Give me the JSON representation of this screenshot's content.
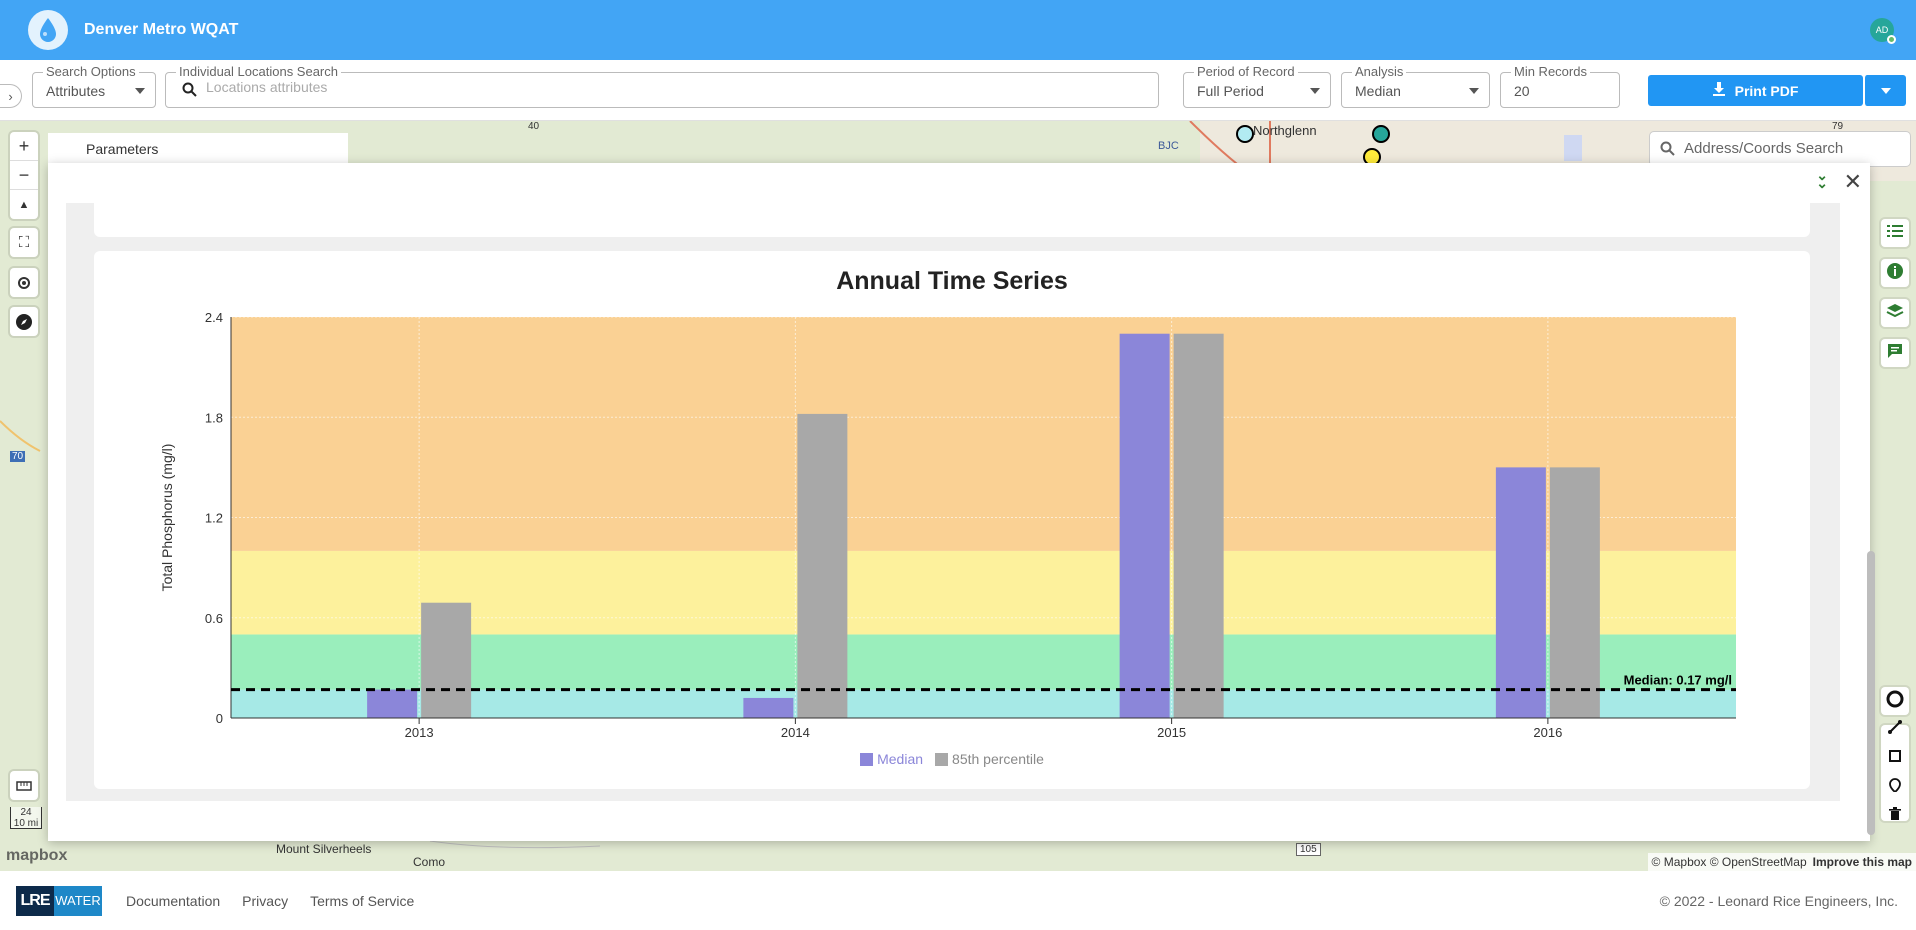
{
  "header": {
    "app_title": "Denver Metro WQAT",
    "avatar_initials": "AD"
  },
  "toolbar": {
    "search_options_label": "Search Options",
    "search_options_value": "Attributes",
    "locations_label": "Individual Locations Search",
    "locations_placeholder": "Locations attributes",
    "period_label": "Period of Record",
    "period_value": "Full Period",
    "analysis_label": "Analysis",
    "analysis_value": "Median",
    "min_records_label": "Min Records",
    "min_records_value": "20",
    "print_label": "Print PDF"
  },
  "map": {
    "address_placeholder": "Address/Coords Search",
    "place_northglenn": "Northglenn",
    "place_bjc": "BJC",
    "place_mount_silverheels": "Mount Silverheels",
    "place_como": "Como",
    "road_40": "40",
    "road_70": "70",
    "road_105": "105",
    "road_79": "79",
    "scale_value": "24",
    "scale_unit": "10 mi",
    "mapbox_text": "mapbox",
    "attribution": "© Mapbox © OpenStreetMap",
    "improve": "Improve this map",
    "panel_label": "Parameters"
  },
  "chart_data": {
    "type": "bar",
    "title": "Annual Time Series",
    "ylabel": "Total Phosphorus (mg/l)",
    "xlabel": "",
    "categories": [
      "2013",
      "2014",
      "2015",
      "2016"
    ],
    "series": [
      {
        "name": "Median",
        "values": [
          0.17,
          0.12,
          2.3,
          1.5
        ],
        "color": "#8b86d9"
      },
      {
        "name": "85th percentile",
        "values": [
          0.69,
          1.82,
          2.3,
          1.5
        ],
        "color": "#a8a8a8"
      }
    ],
    "ylim": [
      0,
      2.4
    ],
    "yticks": [
      "0",
      "0.6",
      "1.2",
      "1.8",
      "2.4"
    ],
    "bands": [
      {
        "from": 0,
        "to": 0.17,
        "color": "#a6e9e6"
      },
      {
        "from": 0.17,
        "to": 0.5,
        "color": "#9aeebc"
      },
      {
        "from": 0.5,
        "to": 1.0,
        "color": "#fdf19c"
      },
      {
        "from": 1.0,
        "to": 2.4,
        "color": "#fad194"
      }
    ],
    "reference_line": {
      "value": 0.17,
      "label": "Median: 0.17 mg/l"
    },
    "grid": true,
    "legend": "bottom-center"
  },
  "footer": {
    "logo_mark": "LRE",
    "logo_text": "WATER",
    "links": [
      "Documentation",
      "Privacy",
      "Terms of Service"
    ],
    "copyright": "© 2022 - Leonard Rice Engineers, Inc."
  }
}
